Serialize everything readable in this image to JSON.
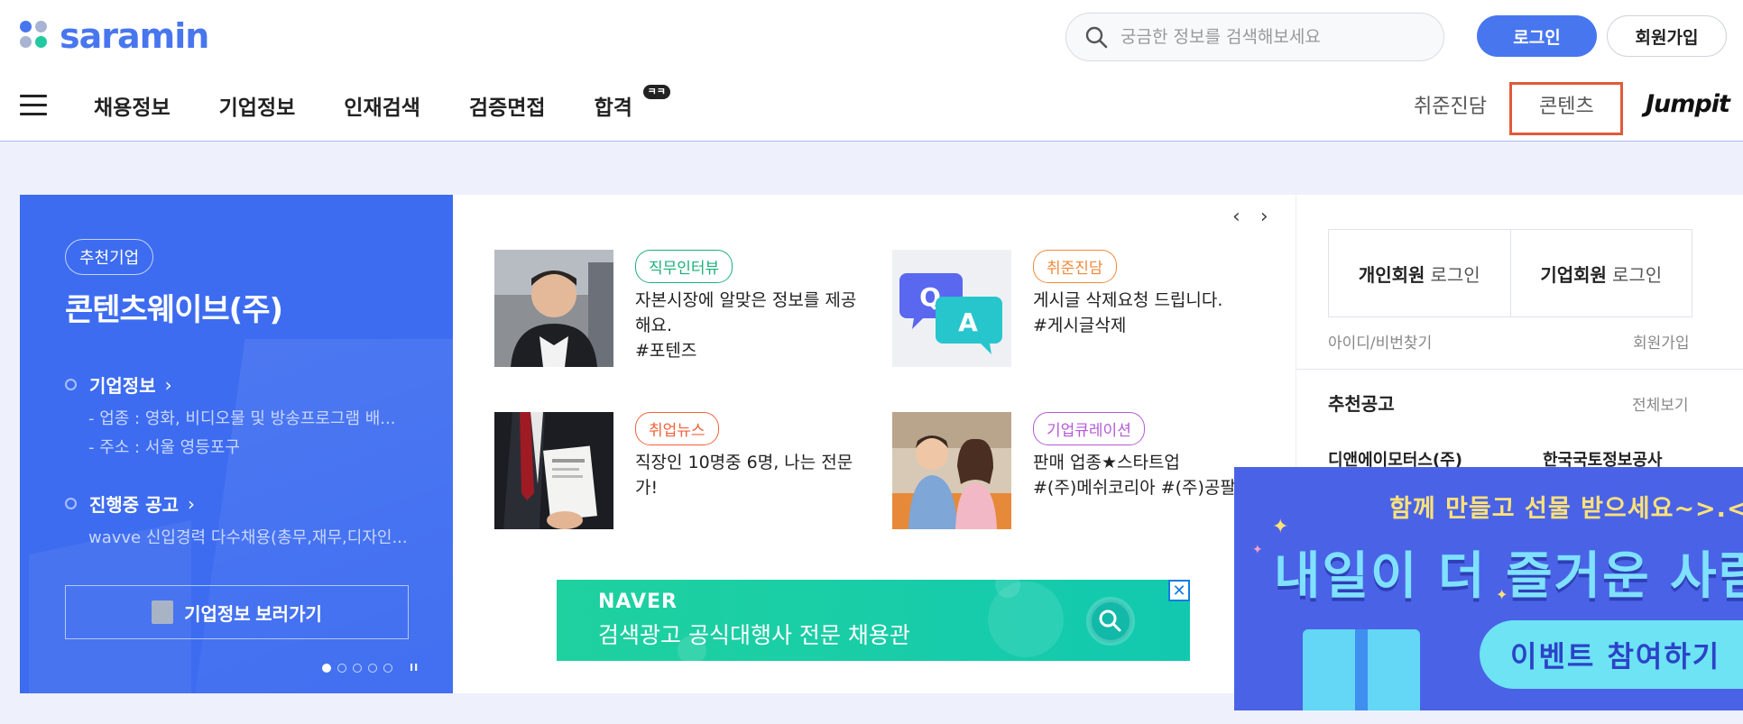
{
  "header": {
    "logo_text": "saramin",
    "search_placeholder": "궁금한 정보를 검색해보세요",
    "login_label": "로그인",
    "join_label": "회원가입"
  },
  "nav": {
    "items": [
      "채용정보",
      "기업정보",
      "인재검색",
      "검증면접",
      "합격"
    ],
    "badge": "ㅋㅋ",
    "right_items": [
      "취준진담",
      "콘텐츠"
    ],
    "jumpit": "Jumpit"
  },
  "promo": {
    "tag": "추천기업",
    "company": "콘텐츠웨이브(주)",
    "section1_title": "기업정보",
    "section1_lines": [
      "- 업종 : 영화, 비디오물 및 방송프로그램 배...",
      "- 주소 : 서울 영등포구"
    ],
    "section2_title": "진행중 공고",
    "section2_line": "wavve 신입경력 다수채용(총무,재무,디자인...",
    "button": "기업정보 보러가기",
    "pause": "II"
  },
  "carousel": {
    "prev": "‹",
    "next": "›"
  },
  "cards": [
    {
      "tag": "직무인터뷰",
      "text": "자본시장에 알맞은 정보를 제공해요.",
      "hashtag": "#포텐즈",
      "tag_color": "#1bb07a"
    },
    {
      "tag": "취준진담",
      "text": "게시글 삭제요청 드립니다.",
      "hashtag": "#게시글삭제",
      "tag_color": "#f08a3c"
    },
    {
      "tag": "취업뉴스",
      "text": "직장인 10명중 6명, 나는 전문가!",
      "hashtag": "",
      "tag_color": "#f0623c"
    },
    {
      "tag": "기업큐레이션",
      "text": "판매 업종★스타트업",
      "hashtag": "#(주)메쉬코리아 #(주)공팔...",
      "tag_color": "#b45ad6"
    }
  ],
  "naver_ad": {
    "brand": "NAVER",
    "copy": "검색광고 공식대행사 전문 채용관",
    "close": "✕"
  },
  "sidebar": {
    "personal_login_bold": "개인회원",
    "personal_login_rest": "로그인",
    "corp_login_bold": "기업회원",
    "corp_login_rest": "로그인",
    "find_account": "아이디/비번찾기",
    "join": "회원가입",
    "rec_title": "추천공고",
    "rec_all": "전체보기",
    "rec_companies": [
      "디앤에이모터스(주)",
      "한국국토정보공사"
    ]
  },
  "event": {
    "line1": "함께 만들고 선물 받으세요~>.<",
    "line2": "내일이 더 즐거운 사람",
    "cta": "이벤트 참여하기"
  }
}
